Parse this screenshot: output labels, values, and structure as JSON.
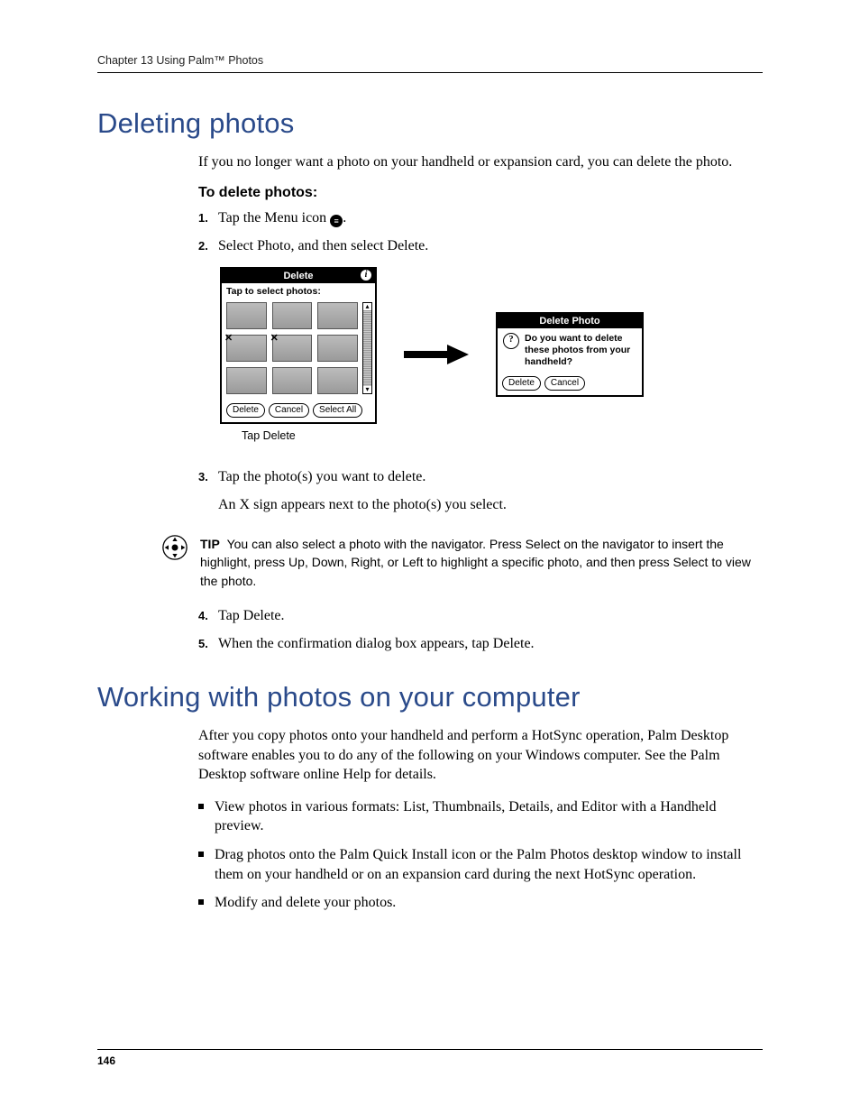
{
  "running_head": "Chapter 13   Using Palm™ Photos",
  "page_number": "146",
  "section1": {
    "title": "Deleting photos",
    "intro": "If you no longer want a photo on your handheld or expansion card, you can delete the photo.",
    "subhead": "To delete photos:",
    "step1_prefix": "Tap the Menu icon ",
    "step1_suffix": ".",
    "step2": "Select Photo, and then select Delete.",
    "step3a": "Tap the photo(s) you want to delete.",
    "step3b": "An X sign appears next to the photo(s) you select.",
    "step4": "Tap Delete.",
    "step5": "When the confirmation dialog box appears, tap Delete.",
    "step_numbers": {
      "s1": "1.",
      "s2": "2.",
      "s3": "3.",
      "s4": "4.",
      "s5": "5."
    }
  },
  "figure": {
    "screen_title": "Delete",
    "screen_sub": "Tap to select photos:",
    "btn_delete": "Delete",
    "btn_cancel": "Cancel",
    "btn_select_all": "Select All",
    "caption": "Tap Delete",
    "dialog_title": "Delete Photo",
    "dialog_text": "Do you want to delete these photos from your handheld?",
    "dialog_btn_delete": "Delete",
    "dialog_btn_cancel": "Cancel"
  },
  "tip": {
    "label": "TIP",
    "text": "You can also select a photo with the navigator. Press Select on the navigator to insert the highlight, press Up, Down, Right, or Left to highlight a specific photo, and then press Select to view the photo."
  },
  "section2": {
    "title": "Working with photos on your computer",
    "intro": "After you copy photos onto your handheld and perform a HotSync operation, Palm Desktop software enables you to do any of the following on your Windows computer. See the Palm Desktop software online Help for details.",
    "b1": "View photos in various formats: List, Thumbnails, Details, and Editor with a Handheld preview.",
    "b2": "Drag photos onto the Palm Quick Install icon or the Palm Photos desktop window to install them on your handheld or on an expansion card during the next HotSync operation.",
    "b3": "Modify and delete your photos."
  }
}
